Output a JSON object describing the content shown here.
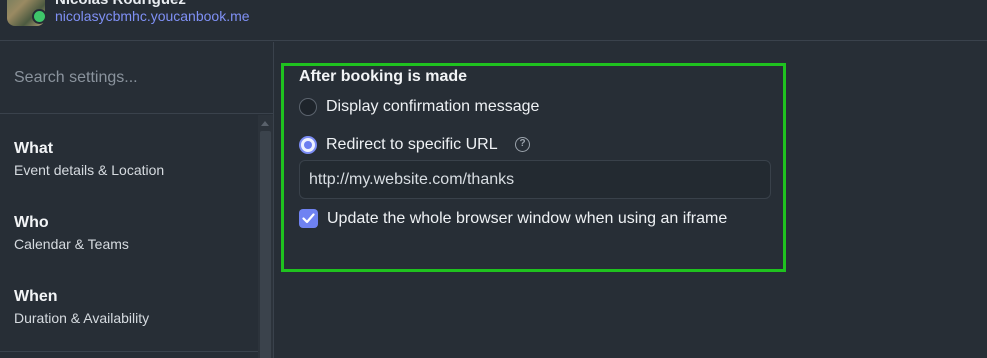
{
  "header": {
    "user_name": "Nicolas Rodriguez",
    "user_url": "nicolasycbmhc.youcanbook.me"
  },
  "sidebar": {
    "search_placeholder": "Search settings...",
    "items": [
      {
        "title": "What",
        "subtitle": "Event details & Location"
      },
      {
        "title": "Who",
        "subtitle": "Calendar & Teams"
      },
      {
        "title": "When",
        "subtitle": "Duration & Availability"
      }
    ]
  },
  "main": {
    "section_title": "After booking is made",
    "options": [
      {
        "label": "Display confirmation message",
        "selected": false
      },
      {
        "label": "Redirect to specific URL",
        "selected": true
      }
    ],
    "help_icon": "question-circle-icon",
    "redirect_url": "http://my.website.com/thanks",
    "iframe_checkbox": {
      "label": "Update the whole browser window when using an iframe",
      "checked": true
    }
  },
  "colors": {
    "accent": "#6f82f2",
    "highlight_border": "#1fc21f",
    "background": "#272e36",
    "link": "#7f90f5"
  }
}
